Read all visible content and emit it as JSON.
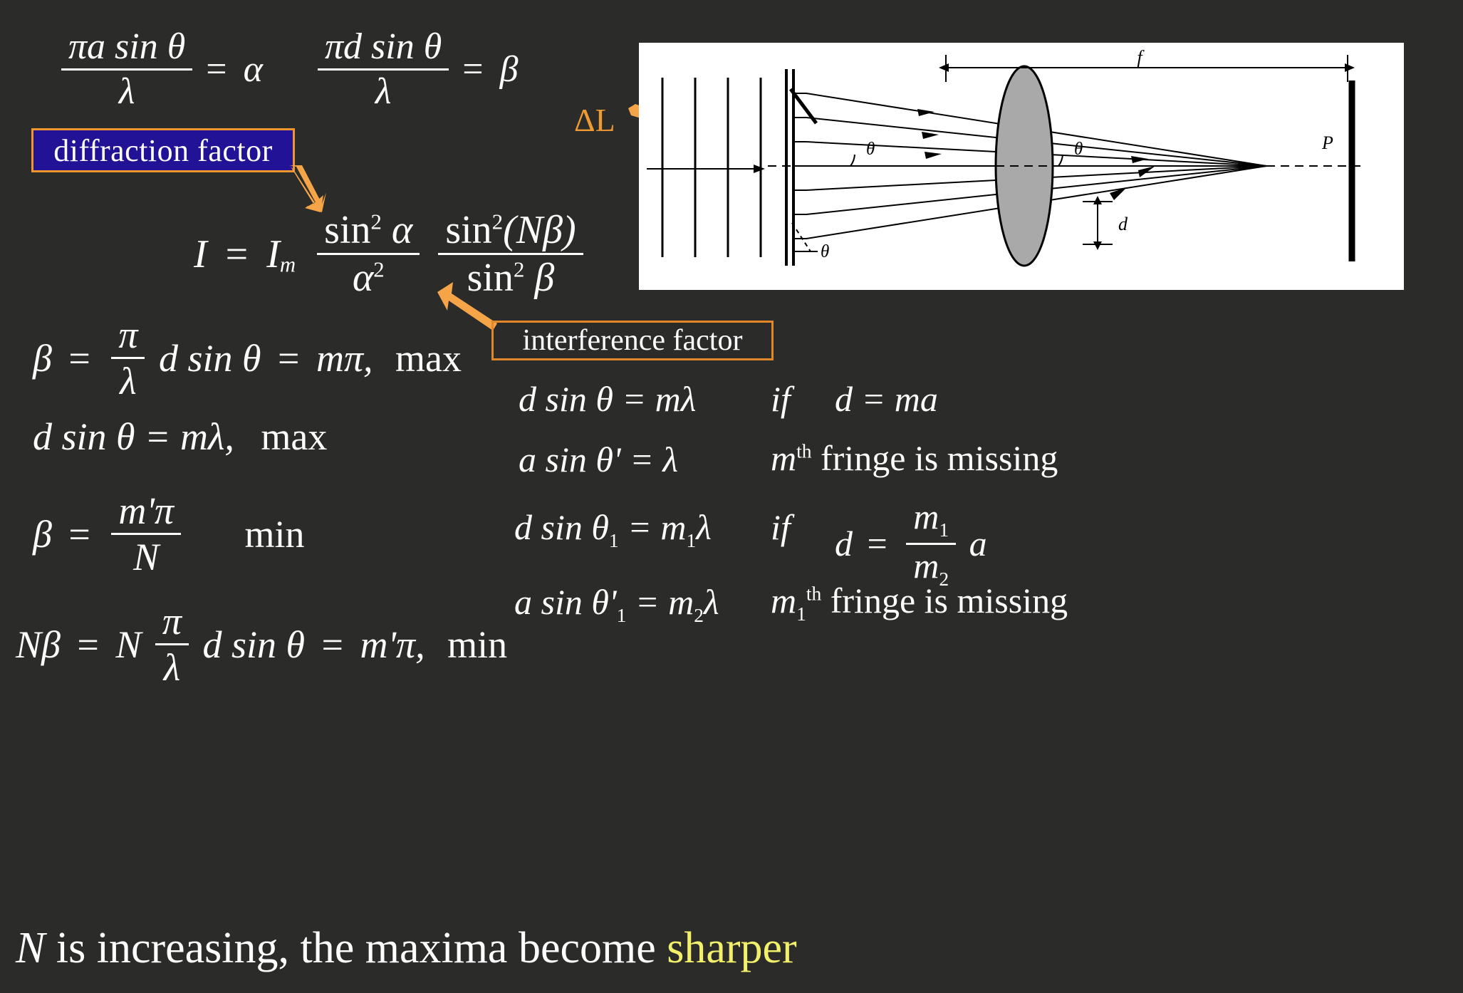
{
  "slide": {
    "background_color": "#2b2b2a",
    "text_color": "#ffffff"
  },
  "equations": {
    "alpha_def": {
      "numerator": "πa sin θ",
      "denominator": "λ",
      "equals": "=",
      "result": "α"
    },
    "beta_def": {
      "numerator": "πd sin θ",
      "denominator": "λ",
      "equals": "=",
      "result": "β"
    },
    "intensity": {
      "lhs": "I",
      "equals": "=",
      "Im": "I",
      "Im_sub": "m",
      "frac1_num_sin": "sin",
      "frac1_num_pow": "2",
      "frac1_num_var": "α",
      "frac1_den_var": "α",
      "frac1_den_pow": "2",
      "frac2_num_sin": "sin",
      "frac2_num_pow": "2",
      "frac2_num_arg": "(Nβ)",
      "frac2_den_sin": "sin",
      "frac2_den_pow": "2",
      "frac2_den_var": "β"
    },
    "beta_max": {
      "lhs": "β",
      "eq1": "=",
      "frac_num": "π",
      "frac_den": "λ",
      "mid": "d sin θ",
      "eq2": "=",
      "rhs": "mπ,",
      "condition": "max"
    },
    "d_sin_max": {
      "expr": "d sin θ = mλ,",
      "condition": "max"
    },
    "beta_min": {
      "lhs": "β",
      "eq": "=",
      "frac_num": "m'π",
      "frac_den": "N",
      "condition": "min"
    },
    "nbeta_min": {
      "lhs": "Nβ",
      "eq1": "=",
      "N": "N",
      "frac_num": "π",
      "frac_den": "λ",
      "mid": "d sin θ",
      "eq2": "=",
      "rhs": "m'π,",
      "condition": "min"
    },
    "right_col": {
      "row1_left": "d sin θ = mλ",
      "row1_if": "if",
      "row1_right": "d = ma",
      "row2_left_a": "a",
      "row2_left_rest": " sin θ' = λ",
      "row2_right_m": "m",
      "row2_right_th": "th",
      "row2_right_rest": " fringe is missing",
      "row3_left_d": "d",
      "row3_left_sin": " sin θ",
      "row3_left_sub": "1",
      "row3_left_eq": " = m",
      "row3_left_sub2": "1",
      "row3_left_lam": "λ",
      "row3_if": "if",
      "row3_right_d": "d",
      "row3_right_eq": "=",
      "row3_frac_num_m": "m",
      "row3_frac_num_sub": "1",
      "row3_frac_den_m": "m",
      "row3_frac_den_sub": "2",
      "row3_right_a": "a",
      "row4_left_a": "a",
      "row4_left_sin": " sin θ'",
      "row4_left_sub": "1",
      "row4_left_eq": " = m",
      "row4_left_sub2": "2",
      "row4_left_lam": "λ",
      "row4_right_m": "m",
      "row4_right_sub": "1",
      "row4_right_th": "th",
      "row4_right_rest": " fringe is missing"
    }
  },
  "labels": {
    "diffraction_factor": "diffraction factor",
    "diffraction_box_fill": "#221296",
    "diffraction_box_border": "#f0962e",
    "interference_factor": "interference factor",
    "interference_box_border": "#e0872a",
    "delta_l": "ΔL",
    "delta_l_color": "#f09a33",
    "arrow_color": "#f5a447"
  },
  "diagram": {
    "name": "grating-lens-screen-diagram",
    "focal_label": "f",
    "point_label": "P",
    "spacing_label": "d",
    "angle_labels": [
      "θ",
      "θ",
      "θ"
    ]
  },
  "bottom_text": {
    "prefix": "N",
    "middle": " is increasing, the maxima become ",
    "highlight": "sharper",
    "highlight_color": "#f2f06a"
  }
}
